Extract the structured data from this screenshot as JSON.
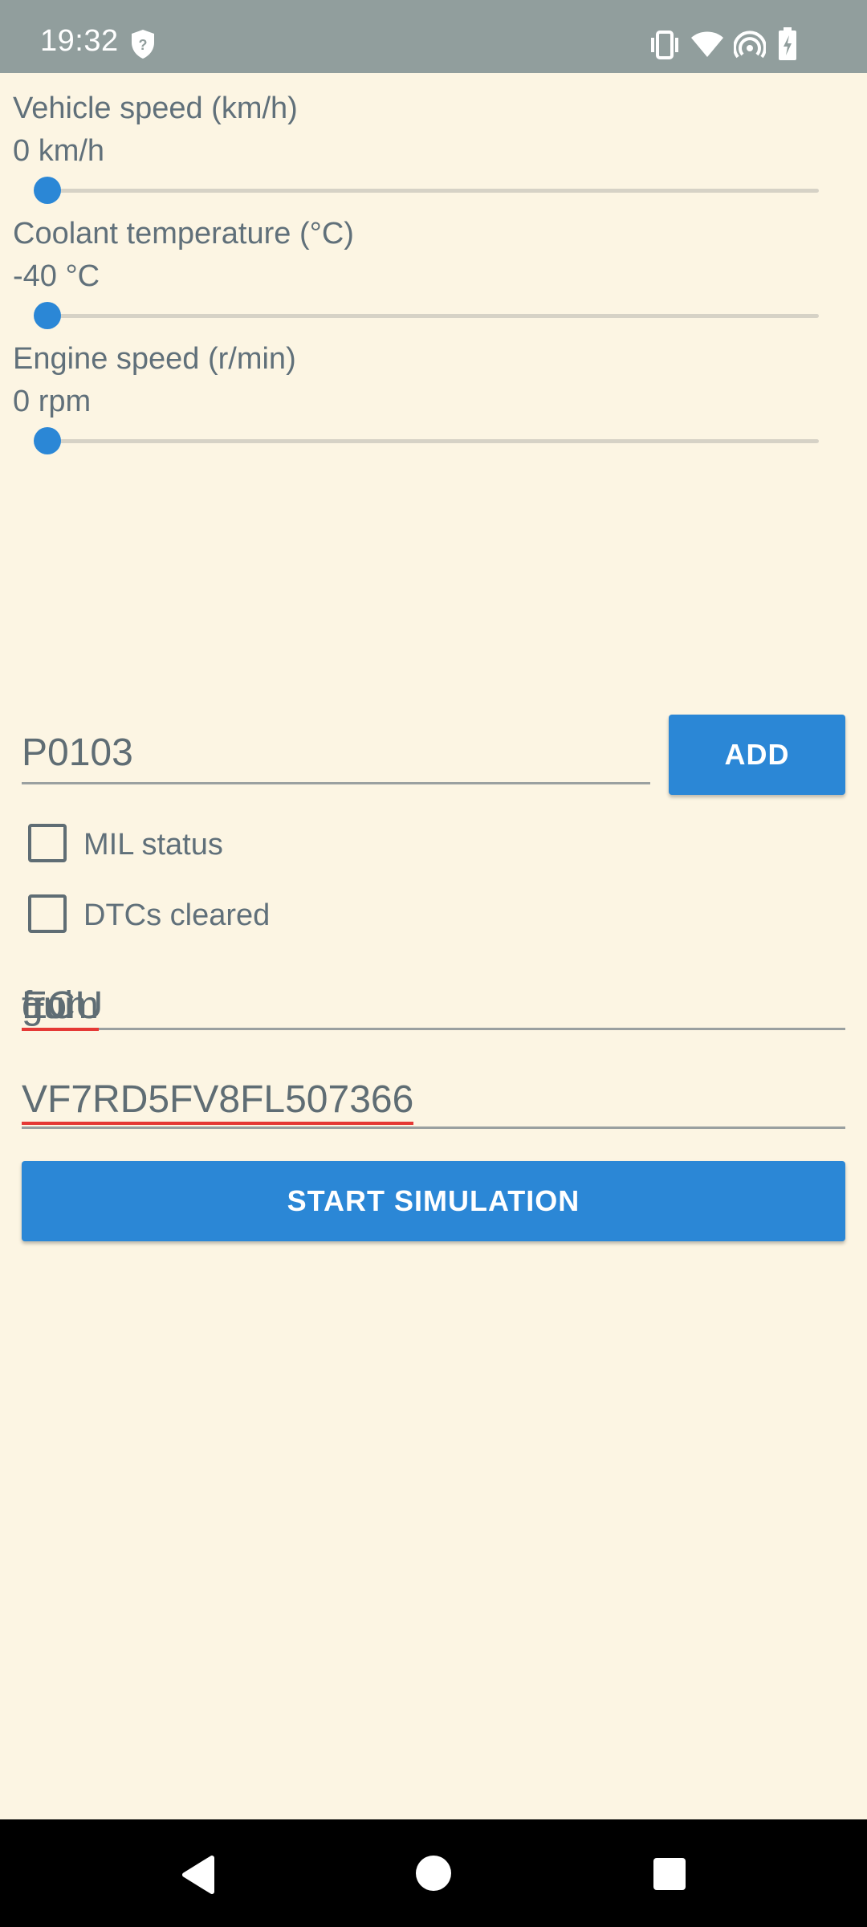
{
  "status_bar": {
    "time": "19:32",
    "icons": [
      "shield-question-icon",
      "vibrate-icon",
      "wifi-icon",
      "hotspot-icon",
      "battery-charging-icon"
    ]
  },
  "sliders": [
    {
      "label": "Vehicle speed (km/h)",
      "value_text": "0 km/h",
      "level": 0
    },
    {
      "label": "Coolant temperature (°C)",
      "value_text": "-40 °C",
      "level": 0
    },
    {
      "label": "Engine speed (r/min)",
      "value_text": "0 rpm",
      "level": 0
    }
  ],
  "dtc": {
    "input_value": "P0103",
    "add_label": "ADD"
  },
  "checkboxes": [
    {
      "label": "MIL status",
      "checked": false
    },
    {
      "label": "DTCs cleared",
      "checked": false
    }
  ],
  "ecu_field": {
    "word1": "ECU",
    "word2": "from",
    "word3": "gui"
  },
  "vin_field": {
    "value": "VF7RD5FV8FL507366"
  },
  "start_button": {
    "label": "START SIMULATION"
  },
  "colors": {
    "background": "#fcf5e3",
    "accent": "#2b87d6",
    "status_bar": "#919e9d",
    "text": "#5f6d74",
    "spellcheck": "#e53935"
  },
  "nav": {
    "icons": [
      "back-icon",
      "home-icon",
      "recents-icon"
    ]
  }
}
